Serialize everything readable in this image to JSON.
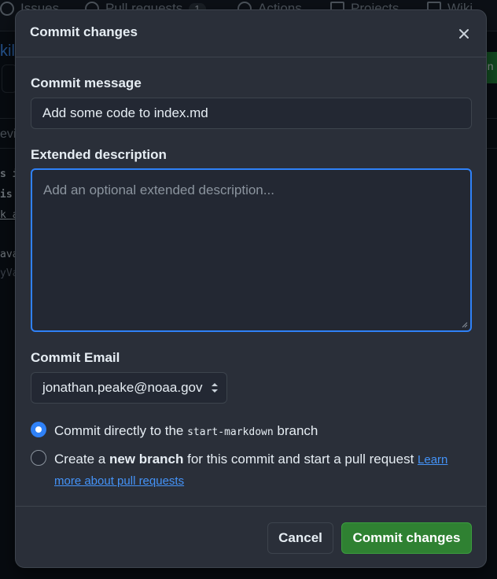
{
  "background": {
    "nav": [
      {
        "label": "Issues",
        "icon": "issue-icon"
      },
      {
        "label": "Pull requests",
        "count": "1",
        "icon": "pull-request-icon"
      },
      {
        "label": "Actions",
        "icon": "actions-icon"
      },
      {
        "label": "Projects",
        "icon": "projects-icon"
      },
      {
        "label": "Wiki",
        "icon": "wiki-icon"
      }
    ],
    "title_fragment": "kill",
    "green_fragment": "nn",
    "tab_fragment": "evie",
    "code_lines": [
      "s i",
      "is",
      "k a",
      "ava",
      "yVa"
    ]
  },
  "modal": {
    "title": "Commit changes",
    "close_icon": "close-icon",
    "commit_message": {
      "label": "Commit message",
      "value": "Add some code to index.md"
    },
    "extended_description": {
      "label": "Extended description",
      "placeholder": "Add an optional extended description..."
    },
    "commit_email": {
      "label": "Commit Email",
      "selected": "jonathan.peake@noaa.gov"
    },
    "options": {
      "direct": {
        "prefix": "Commit directly to the ",
        "branch": "start-markdown",
        "suffix": " branch",
        "checked": true
      },
      "new_branch": {
        "prefix": "Create a ",
        "bold": "new branch",
        "suffix": " for this commit and start a pull request ",
        "link": "Learn more about pull requests",
        "checked": false
      }
    },
    "buttons": {
      "cancel": "Cancel",
      "commit": "Commit changes"
    }
  },
  "colors": {
    "accent": "#2f81f7",
    "primary_button": "#2f8132",
    "link": "#4493f8"
  }
}
